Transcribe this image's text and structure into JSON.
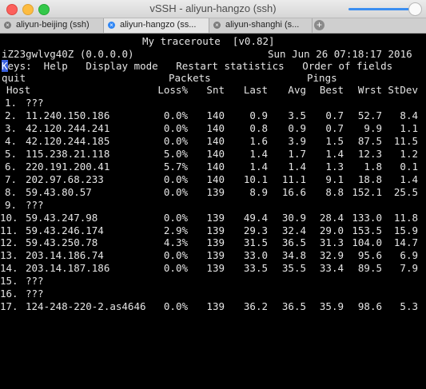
{
  "window": {
    "title": "vSSH - aliyun-hangzo (ssh)"
  },
  "tabs": [
    {
      "label": "aliyun-beijing (ssh)",
      "close": "×"
    },
    {
      "label": "aliyun-hangzo (ss...",
      "close": "×"
    },
    {
      "label": "aliyun-shanghi (s...",
      "close": "×"
    }
  ],
  "add_tab": "+",
  "terminal": {
    "program_title": "My traceroute  [v0.82]",
    "host_line": "iZ23gwlvg40Z (0.0.0.0)",
    "datetime": "Sun Jun 26 07:18:17 2016",
    "keys_first": "K",
    "keys_rest": "eys:  Help   Display mode   Restart statistics   Order of fields",
    "quit": "quit",
    "group_packets": "Packets",
    "group_pings": "Pings",
    "headers": {
      "host": "Host",
      "loss": "Loss%",
      "snt": "Snt",
      "last": "Last",
      "avg": "Avg",
      "best": "Best",
      "wrst": "Wrst",
      "stdev": "StDev"
    },
    "hops": [
      {
        "n": "1.",
        "host": "???",
        "loss": "",
        "snt": "",
        "last": "",
        "avg": "",
        "best": "",
        "wrst": "",
        "stdev": ""
      },
      {
        "n": "2.",
        "host": "11.240.150.186",
        "loss": "0.0%",
        "snt": "140",
        "last": "0.9",
        "avg": "3.5",
        "best": "0.7",
        "wrst": "52.7",
        "stdev": "8.4"
      },
      {
        "n": "3.",
        "host": "42.120.244.241",
        "loss": "0.0%",
        "snt": "140",
        "last": "0.8",
        "avg": "0.9",
        "best": "0.7",
        "wrst": "9.9",
        "stdev": "1.1"
      },
      {
        "n": "4.",
        "host": "42.120.244.185",
        "loss": "0.0%",
        "snt": "140",
        "last": "1.6",
        "avg": "3.9",
        "best": "1.5",
        "wrst": "87.5",
        "stdev": "11.5"
      },
      {
        "n": "5.",
        "host": "115.238.21.118",
        "loss": "5.0%",
        "snt": "140",
        "last": "1.4",
        "avg": "1.7",
        "best": "1.4",
        "wrst": "12.3",
        "stdev": "1.2"
      },
      {
        "n": "6.",
        "host": "220.191.200.41",
        "loss": "5.7%",
        "snt": "140",
        "last": "1.4",
        "avg": "1.4",
        "best": "1.3",
        "wrst": "1.8",
        "stdev": "0.1"
      },
      {
        "n": "7.",
        "host": "202.97.68.233",
        "loss": "0.0%",
        "snt": "140",
        "last": "10.1",
        "avg": "11.1",
        "best": "9.1",
        "wrst": "18.8",
        "stdev": "1.4"
      },
      {
        "n": "8.",
        "host": "59.43.80.57",
        "loss": "0.0%",
        "snt": "139",
        "last": "8.9",
        "avg": "16.6",
        "best": "8.8",
        "wrst": "152.1",
        "stdev": "25.5"
      },
      {
        "n": "9.",
        "host": "???",
        "loss": "",
        "snt": "",
        "last": "",
        "avg": "",
        "best": "",
        "wrst": "",
        "stdev": ""
      },
      {
        "n": "10.",
        "host": "59.43.247.98",
        "loss": "0.0%",
        "snt": "139",
        "last": "49.4",
        "avg": "30.9",
        "best": "28.4",
        "wrst": "133.0",
        "stdev": "11.8"
      },
      {
        "n": "11.",
        "host": "59.43.246.174",
        "loss": "2.9%",
        "snt": "139",
        "last": "29.3",
        "avg": "32.4",
        "best": "29.0",
        "wrst": "153.5",
        "stdev": "15.9"
      },
      {
        "n": "12.",
        "host": "59.43.250.78",
        "loss": "4.3%",
        "snt": "139",
        "last": "31.5",
        "avg": "36.5",
        "best": "31.3",
        "wrst": "104.0",
        "stdev": "14.7"
      },
      {
        "n": "13.",
        "host": "203.14.186.74",
        "loss": "0.0%",
        "snt": "139",
        "last": "33.0",
        "avg": "34.8",
        "best": "32.9",
        "wrst": "95.6",
        "stdev": "6.9"
      },
      {
        "n": "14.",
        "host": "203.14.187.186",
        "loss": "0.0%",
        "snt": "139",
        "last": "33.5",
        "avg": "35.5",
        "best": "33.4",
        "wrst": "89.5",
        "stdev": "7.9"
      },
      {
        "n": "15.",
        "host": "???",
        "loss": "",
        "snt": "",
        "last": "",
        "avg": "",
        "best": "",
        "wrst": "",
        "stdev": ""
      },
      {
        "n": "16.",
        "host": "???",
        "loss": "",
        "snt": "",
        "last": "",
        "avg": "",
        "best": "",
        "wrst": "",
        "stdev": ""
      },
      {
        "n": "17.",
        "host": "124-248-220-2.as4646",
        "loss": "0.0%",
        "snt": "139",
        "last": "36.2",
        "avg": "36.5",
        "best": "35.9",
        "wrst": "98.6",
        "stdev": "5.3"
      }
    ]
  }
}
